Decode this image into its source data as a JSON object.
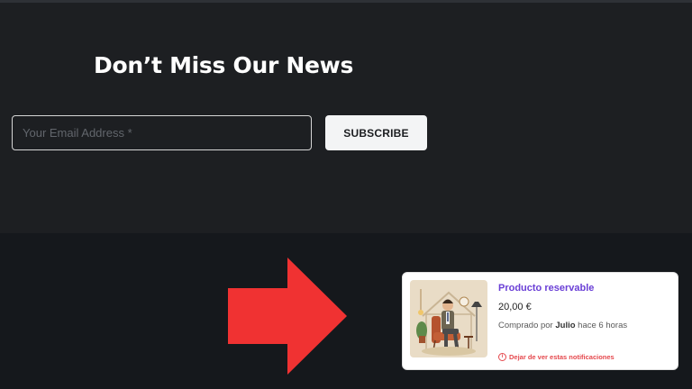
{
  "newsletter": {
    "title": "Don’t Miss Our News",
    "email_placeholder": "Your Email Address *",
    "subscribe_label": "SUBSCRIBE"
  },
  "notification": {
    "product_name": "Producto reservable",
    "price": "20,00 €",
    "bought_prefix": "Comprado por ",
    "buyer": "Julio",
    "bought_suffix": " hace 6 horas",
    "dismiss_label": "Dejar de ver estas notificaciones",
    "image": "product-illustration-man-in-chair"
  },
  "icons": {
    "arrow": "right-arrow-icon",
    "info": "info-icon"
  },
  "colors": {
    "page_bg": "#15181c",
    "newsletter_bg": "#1d1f22",
    "arrow": "#f03232",
    "product_link": "#6a3fd6",
    "dismiss": "#e5484d"
  }
}
